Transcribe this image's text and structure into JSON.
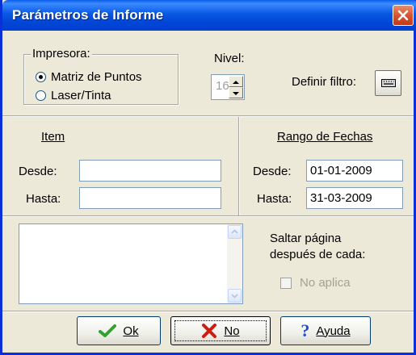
{
  "window": {
    "title": "Parámetros de Informe"
  },
  "printer": {
    "group_label": "Impresora:",
    "options": [
      {
        "label": "Matriz de Puntos",
        "checked": true
      },
      {
        "label": "Laser/Tinta",
        "checked": false
      }
    ]
  },
  "level": {
    "label": "Nivel:",
    "value": "16"
  },
  "filter": {
    "label": "Definir filtro:",
    "icon": "keyboard-icon"
  },
  "item": {
    "header": "Item",
    "from_label": "Desde:",
    "from_value": "",
    "to_label": "Hasta:",
    "to_value": ""
  },
  "date_range": {
    "header": "Rango de Fechas",
    "from_label": "Desde:",
    "from_value": "01-01-2009",
    "to_label": "Hasta:",
    "to_value": "31-03-2009"
  },
  "page_break": {
    "label_line1": "Saltar página",
    "label_line2": "después de cada:",
    "checkbox_label": "No aplica",
    "checked": false
  },
  "buttons": {
    "ok": {
      "label": "Ok",
      "icon": "checkmark-icon"
    },
    "no": {
      "label": "No",
      "icon": "x-icon"
    },
    "help": {
      "label": "Ayuda",
      "icon": "question-icon"
    }
  },
  "colors": {
    "titlebar": "#0a5fe8",
    "window_bg": "#ece9d8",
    "ok_check": "#2ea32e",
    "no_x": "#cc1d10",
    "help_q": "#1e4fd0"
  }
}
